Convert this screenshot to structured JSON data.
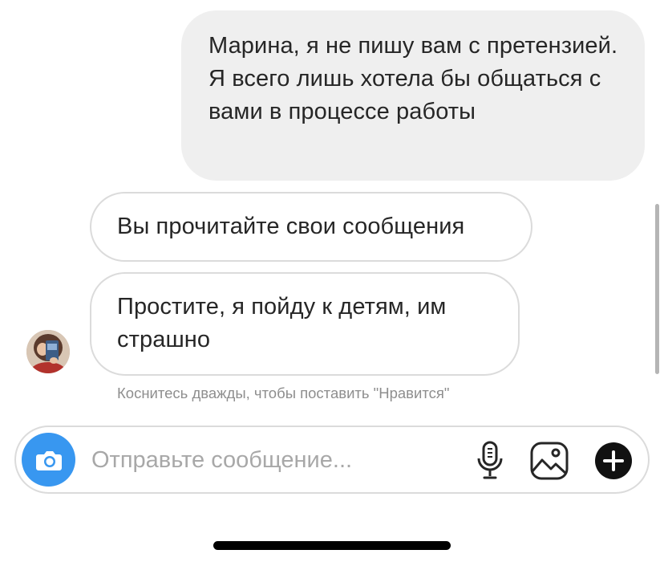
{
  "messages": {
    "outgoing_1": "Марина, я не пишу вам с претензией. Я всего лишь хотела бы общаться с вами в процессе работы",
    "incoming_1": "Вы прочитайте свои сообщения",
    "incoming_2": "Простите, я пойду к детям, им страшно"
  },
  "hint": "Коснитесь дважды, чтобы поставить \"Нравится\"",
  "composer": {
    "placeholder": "Отправьте сообщение...",
    "icons": [
      "camera-icon",
      "microphone-icon",
      "gallery-icon",
      "plus-icon"
    ]
  },
  "colors": {
    "accent": "#3897f0",
    "outgoing_bubble": "#efefef",
    "incoming_border": "#dbdbdb",
    "hint_text": "#8e8e8e",
    "text": "#262626"
  }
}
